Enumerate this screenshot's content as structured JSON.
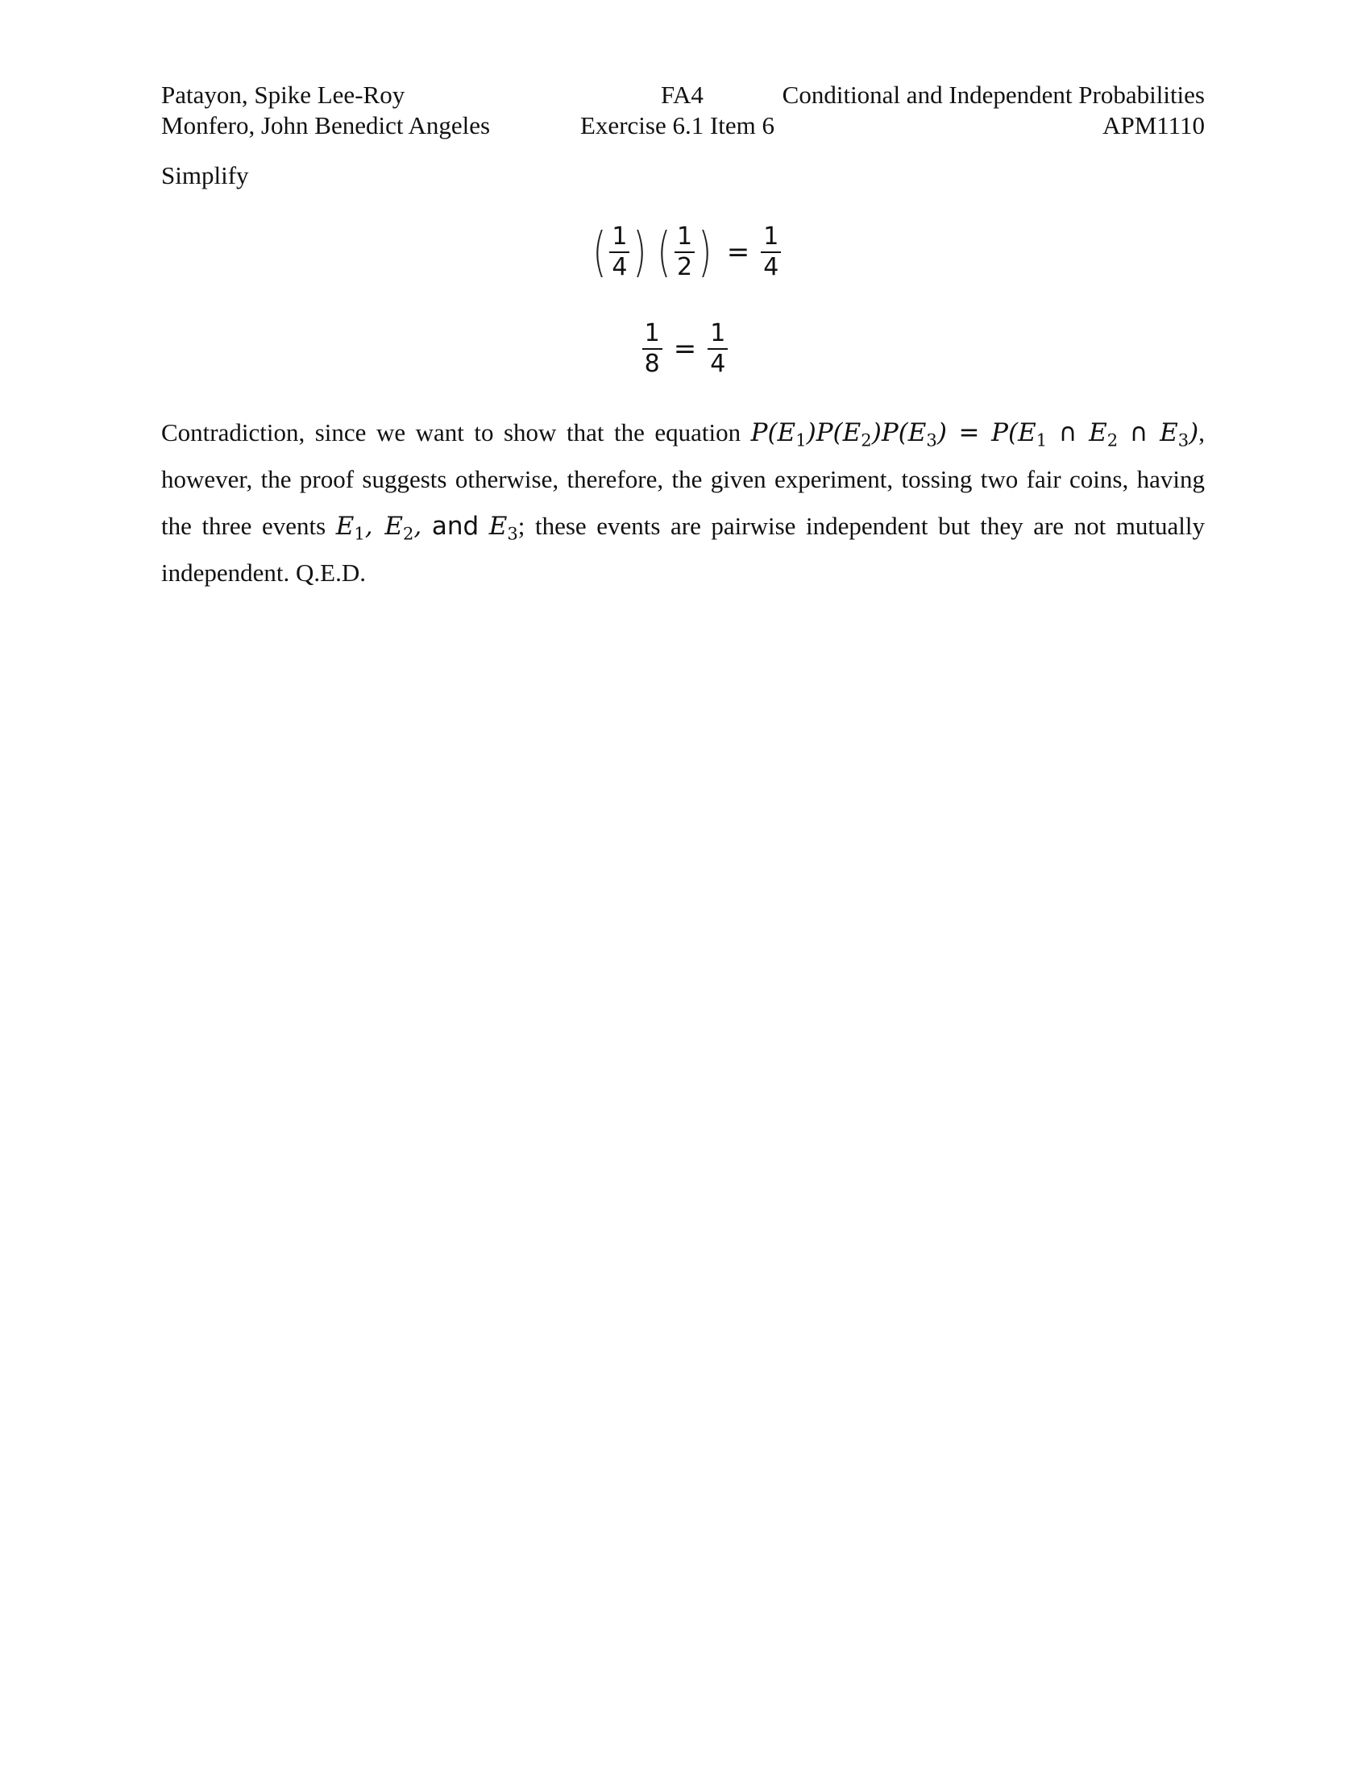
{
  "header": {
    "author1": "Patayon, Spike Lee-Roy",
    "author2": "Monfero, John Benedict Angeles",
    "code": "FA4",
    "topic": "Conditional and Independent Probabilities",
    "exercise": "Exercise 6.1 Item 6",
    "course": "APM1110"
  },
  "body": {
    "instruction": "Simplify",
    "eq1": {
      "f1_num": "1",
      "f1_den": "4",
      "f2_num": "1",
      "f2_den": "2",
      "equals": "=",
      "r_num": "1",
      "r_den": "4"
    },
    "eq2": {
      "l_num": "1",
      "l_den": "8",
      "equals": "=",
      "r_num": "1",
      "r_den": "4"
    },
    "conclusion": {
      "p1": "Contradiction, since we want to show that the equation ",
      "p2": ", however, the proof suggests otherwise, therefore, the given experiment, tossing two fair coins, having the three events ",
      "and_word": "and",
      "p3": "; these events are pairwise independent but they are not mutually independent. Q.E.D."
    }
  }
}
